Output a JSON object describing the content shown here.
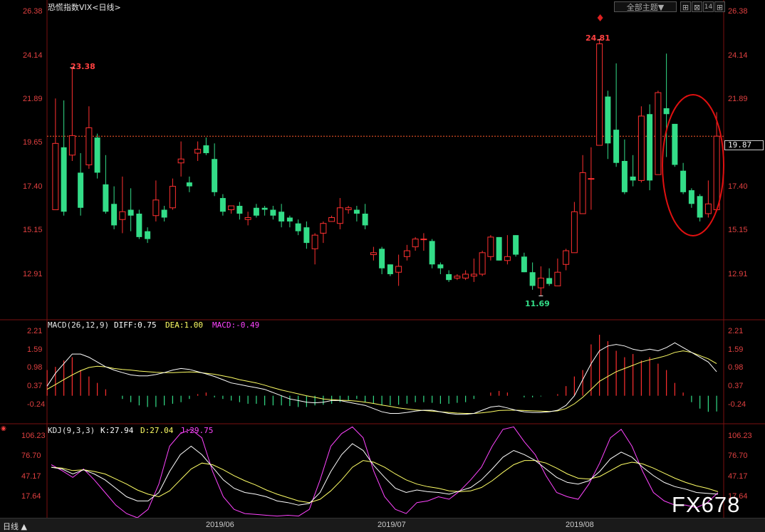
{
  "main_title": "恐慌指数VIX<日线>",
  "theme_button": "全部主题▼",
  "tool_buttons": [
    "⊞",
    "⊠",
    "14",
    "⊞"
  ],
  "price_axis": [
    "26.38",
    "24.14",
    "21.89",
    "19.65",
    "17.40",
    "15.15",
    "12.91"
  ],
  "current_price": "19.87",
  "annotations": {
    "high1": "23.38",
    "high2": "24.81",
    "low": "11.69"
  },
  "macd": {
    "name": "MACD(26,12,9)",
    "diff": "DIFF:0.75",
    "dea": "DEA:1.00",
    "macd": "MACD:-0.49",
    "axis": [
      "2.21",
      "1.59",
      "0.98",
      "0.37",
      "-0.24"
    ]
  },
  "kdj": {
    "name": "KDJ(9,3,3)",
    "k": "K:27.94",
    "d": "D:27.04",
    "j": "J:29.75",
    "axis": [
      "106.23",
      "76.70",
      "47.17",
      "17.64"
    ]
  },
  "dates": [
    "2019/06",
    "2019/07",
    "2019/08"
  ],
  "period_label": "日线 ▲",
  "watermark": "FX678",
  "colors": {
    "up": "#ff3030",
    "down": "#33dd88",
    "diff": "#ffffff",
    "dea": "#ffff66",
    "j": "#ff44ff"
  },
  "chart_data": [
    {
      "type": "candlestick",
      "title": "恐慌指数VIX<日线>",
      "ylim": [
        10.5,
        26.7
      ],
      "ohlc": [
        [
          16.1,
          19.5,
          16.1,
          21.8
        ],
        [
          19.3,
          16.0,
          15.8,
          21.7
        ],
        [
          18.9,
          19.9,
          18.6,
          23.38
        ],
        [
          18.0,
          16.2,
          15.8,
          19.0
        ],
        [
          18.4,
          20.3,
          18.2,
          21.4
        ],
        [
          19.8,
          18.0,
          17.7,
          20.0
        ],
        [
          17.4,
          16.0,
          15.9,
          18.9
        ],
        [
          16.4,
          15.3,
          15.1,
          17.3
        ],
        [
          15.6,
          16.0,
          14.9,
          17.8
        ],
        [
          16.1,
          15.8,
          15.0,
          17.2
        ],
        [
          15.9,
          14.7,
          14.6,
          16.1
        ],
        [
          15.0,
          14.6,
          14.4,
          15.2
        ],
        [
          15.8,
          16.6,
          15.5,
          17.6
        ],
        [
          16.1,
          15.7,
          15.5,
          16.3
        ],
        [
          16.2,
          17.3,
          16.1,
          17.7
        ],
        [
          18.5,
          18.7,
          17.8,
          19.6
        ],
        [
          17.5,
          17.3,
          17.0,
          17.8
        ],
        [
          19.0,
          19.2,
          18.6,
          19.6
        ],
        [
          19.4,
          19.0,
          18.9,
          19.8
        ],
        [
          18.7,
          17.0,
          16.8,
          19.5
        ],
        [
          16.7,
          16.0,
          15.8,
          16.9
        ],
        [
          16.1,
          16.3,
          15.9,
          16.3
        ],
        [
          16.3,
          15.9,
          15.6,
          16.5
        ],
        [
          15.6,
          15.7,
          15.3,
          16.0
        ],
        [
          16.2,
          15.8,
          15.7,
          16.4
        ],
        [
          16.2,
          16.1,
          15.8,
          16.3
        ],
        [
          16.1,
          15.8,
          15.6,
          16.3
        ],
        [
          16.0,
          15.5,
          15.2,
          16.4
        ],
        [
          15.7,
          15.5,
          15.2,
          15.8
        ],
        [
          15.4,
          15.0,
          14.8,
          15.6
        ],
        [
          15.2,
          14.4,
          14.1,
          15.5
        ],
        [
          14.1,
          14.8,
          13.3,
          14.9
        ],
        [
          14.9,
          15.4,
          14.4,
          15.5
        ],
        [
          15.5,
          15.7,
          15.5,
          15.8
        ],
        [
          15.4,
          16.2,
          15.1,
          16.7
        ],
        [
          16.1,
          16.2,
          15.9,
          16.3
        ],
        [
          16.1,
          15.9,
          15.5,
          16.3
        ],
        [
          15.9,
          15.3,
          15.1,
          16.4
        ],
        [
          13.8,
          13.9,
          13.5,
          14.2
        ],
        [
          14.1,
          13.1,
          12.8,
          14.2
        ],
        [
          13.3,
          12.8,
          12.7,
          13.3
        ],
        [
          12.9,
          13.2,
          12.2,
          13.8
        ],
        [
          13.7,
          14.0,
          13.5,
          14.3
        ],
        [
          14.2,
          14.6,
          14.0,
          14.7
        ],
        [
          14.6,
          14.6,
          14.0,
          14.9
        ],
        [
          14.5,
          13.3,
          13.1,
          14.6
        ],
        [
          13.3,
          13.1,
          12.8,
          13.4
        ],
        [
          12.8,
          12.5,
          12.4,
          13.0
        ],
        [
          12.6,
          12.7,
          12.5,
          12.8
        ],
        [
          12.6,
          12.8,
          12.5,
          13.0
        ],
        [
          12.7,
          12.8,
          12.4,
          13.6
        ],
        [
          12.8,
          13.9,
          12.7,
          14.0
        ],
        [
          13.7,
          14.7,
          13.5,
          14.8
        ],
        [
          14.7,
          13.5,
          13.5,
          14.7
        ],
        [
          13.5,
          13.7,
          13.3,
          14.8
        ],
        [
          14.8,
          13.8,
          13.7,
          14.8
        ],
        [
          13.7,
          12.9,
          12.9,
          13.9
        ],
        [
          12.9,
          12.2,
          12.0,
          13.4
        ],
        [
          12.1,
          12.6,
          11.69,
          13.2
        ],
        [
          12.6,
          12.3,
          12.2,
          13.1
        ],
        [
          12.2,
          12.9,
          12.2,
          13.6
        ],
        [
          13.3,
          14.0,
          13.0,
          14.1
        ],
        [
          13.9,
          16.0,
          13.9,
          16.5
        ],
        [
          15.9,
          18.0,
          15.9,
          18.9
        ],
        [
          17.7,
          17.7,
          16.1,
          19.3
        ],
        [
          19.4,
          24.6,
          19.4,
          24.81
        ],
        [
          21.9,
          19.5,
          18.7,
          22.2
        ],
        [
          20.2,
          18.5,
          18.3,
          23.6
        ],
        [
          18.6,
          17.0,
          16.9,
          19.7
        ],
        [
          17.8,
          17.6,
          17.3,
          18.9
        ],
        [
          17.6,
          20.9,
          17.5,
          21.4
        ],
        [
          21.0,
          17.6,
          17.1,
          21.5
        ],
        [
          17.9,
          22.1,
          17.9,
          22.2
        ],
        [
          21.3,
          21.0,
          18.8,
          24.1
        ],
        [
          20.5,
          18.4,
          18.3,
          20.5
        ],
        [
          18.1,
          17.0,
          16.9,
          18.5
        ],
        [
          17.1,
          16.4,
          16.2,
          17.2
        ],
        [
          16.8,
          15.7,
          15.5,
          16.9
        ],
        [
          15.9,
          16.4,
          15.7,
          17.6
        ],
        [
          16.1,
          19.87,
          16.0,
          21.1
        ]
      ]
    },
    {
      "type": "bar_line",
      "title": "MACD(26,12,9)",
      "ylim": [
        -0.85,
        2.3
      ],
      "macd": [
        0.8,
        0.9,
        1.1,
        1.2,
        0.8,
        0.6,
        0.4,
        0.2,
        0.0,
        -0.1,
        -0.2,
        -0.3,
        -0.35,
        -0.35,
        -0.3,
        -0.25,
        -0.2,
        -0.1,
        0.05,
        0.1,
        -0.05,
        -0.1,
        -0.15,
        -0.2,
        -0.25,
        -0.25,
        -0.3,
        -0.3,
        -0.3,
        -0.32,
        -0.35,
        -0.35,
        -0.3,
        -0.28,
        -0.25,
        -0.2,
        -0.15,
        -0.1,
        -0.2,
        -0.25,
        -0.3,
        -0.3,
        -0.28,
        -0.25,
        -0.2,
        -0.2,
        -0.22,
        -0.25,
        -0.25,
        -0.22,
        -0.2,
        -0.1,
        0.0,
        0.1,
        0.15,
        0.1,
        0.0,
        -0.05,
        -0.05,
        -0.02,
        0.0,
        0.05,
        0.3,
        0.6,
        0.8,
        1.6,
        1.9,
        1.7,
        1.4,
        1.2,
        1.3,
        1.1,
        1.2,
        1.0,
        0.8,
        0.4,
        0.1,
        -0.2,
        -0.4,
        -0.5,
        -0.49
      ],
      "diff": [
        0.3,
        0.7,
        1.0,
        1.3,
        1.3,
        1.2,
        1.05,
        0.9,
        0.8,
        0.72,
        0.65,
        0.62,
        0.62,
        0.66,
        0.72,
        0.8,
        0.85,
        0.82,
        0.75,
        0.68,
        0.6,
        0.5,
        0.4,
        0.35,
        0.3,
        0.25,
        0.2,
        0.1,
        0.0,
        -0.1,
        -0.15,
        -0.2,
        -0.22,
        -0.2,
        -0.15,
        -0.15,
        -0.2,
        -0.25,
        -0.3,
        -0.4,
        -0.5,
        -0.55,
        -0.55,
        -0.52,
        -0.48,
        -0.45,
        -0.45,
        -0.5,
        -0.55,
        -0.58,
        -0.58,
        -0.55,
        -0.45,
        -0.35,
        -0.32,
        -0.38,
        -0.45,
        -0.5,
        -0.52,
        -0.52,
        -0.5,
        -0.45,
        -0.3,
        0.0,
        0.5,
        1.0,
        1.4,
        1.55,
        1.6,
        1.55,
        1.45,
        1.4,
        1.45,
        1.4,
        1.5,
        1.65,
        1.5,
        1.35,
        1.2,
        1.05,
        0.75
      ],
      "dea": [
        0.2,
        0.35,
        0.5,
        0.65,
        0.78,
        0.88,
        0.92,
        0.9,
        0.85,
        0.82,
        0.8,
        0.77,
        0.75,
        0.73,
        0.72,
        0.72,
        0.73,
        0.74,
        0.73,
        0.7,
        0.67,
        0.62,
        0.57,
        0.5,
        0.45,
        0.4,
        0.33,
        0.25,
        0.18,
        0.12,
        0.06,
        0.0,
        -0.05,
        -0.1,
        -0.12,
        -0.14,
        -0.15,
        -0.17,
        -0.2,
        -0.24,
        -0.29,
        -0.33,
        -0.38,
        -0.41,
        -0.44,
        -0.46,
        -0.48,
        -0.5,
        -0.52,
        -0.54,
        -0.55,
        -0.55,
        -0.53,
        -0.5,
        -0.46,
        -0.45,
        -0.45,
        -0.46,
        -0.47,
        -0.48,
        -0.49,
        -0.47,
        -0.4,
        -0.25,
        -0.05,
        0.2,
        0.45,
        0.6,
        0.75,
        0.85,
        0.95,
        1.05,
        1.12,
        1.18,
        1.25,
        1.35,
        1.4,
        1.35,
        1.25,
        1.15,
        1.0
      ]
    },
    {
      "type": "line",
      "title": "KDJ(9,3,3)",
      "ylim": [
        0,
        110
      ],
      "k": [
        60,
        58,
        52,
        57,
        52,
        45,
        35,
        25,
        20,
        20,
        30,
        55,
        75,
        85,
        75,
        60,
        45,
        35,
        30,
        28,
        25,
        20,
        18,
        15,
        17,
        30,
        55,
        75,
        88,
        80,
        62,
        48,
        35,
        30,
        33,
        31,
        30,
        28,
        32,
        36,
        45,
        58,
        72,
        80,
        75,
        68,
        58,
        48,
        42,
        40,
        44,
        55,
        70,
        78,
        72,
        60,
        50,
        42,
        37,
        34,
        30,
        29,
        28
      ],
      "d": [
        60,
        59,
        56,
        57,
        55,
        52,
        46,
        40,
        33,
        28,
        25,
        32,
        45,
        58,
        65,
        63,
        57,
        50,
        44,
        39,
        33,
        28,
        24,
        20,
        18,
        22,
        32,
        45,
        60,
        68,
        66,
        60,
        52,
        45,
        40,
        37,
        35,
        32,
        31,
        32,
        36,
        44,
        54,
        63,
        68,
        68,
        65,
        59,
        52,
        47,
        46,
        49,
        56,
        63,
        66,
        64,
        59,
        53,
        47,
        42,
        38,
        35,
        31
      ],
      "j": [
        63,
        56,
        48,
        58,
        45,
        30,
        15,
        5,
        0,
        10,
        40,
        85,
        100,
        105,
        95,
        55,
        25,
        10,
        5,
        4,
        3,
        2,
        3,
        2,
        10,
        45,
        85,
        100,
        108,
        95,
        55,
        25,
        10,
        5,
        18,
        20,
        25,
        22,
        32,
        45,
        60,
        85,
        105,
        108,
        90,
        75,
        50,
        30,
        25,
        22,
        40,
        65,
        95,
        105,
        85,
        55,
        30,
        20,
        15,
        15,
        12,
        18,
        29.75
      ]
    }
  ]
}
